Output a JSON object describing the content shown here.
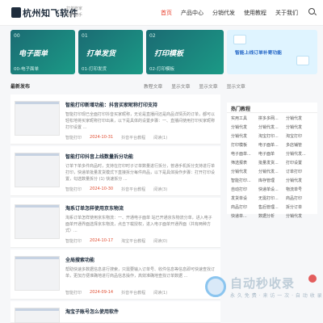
{
  "header": {
    "logo": "杭州知飞软件",
    "slogan": [
      "打单管家",
      "我的助手"
    ],
    "nav": [
      "首页",
      "产品中心",
      "分销代发",
      "使用教程",
      "关于我们"
    ],
    "active": "首页"
  },
  "banners": [
    {
      "num": "00",
      "title": "电子面单",
      "caption": "00-电子面单"
    },
    {
      "num": "01",
      "title": "打单发货",
      "caption": "01-打印发货"
    },
    {
      "num": "02",
      "title": "打印模板",
      "caption": "02-打印模板"
    }
  ],
  "big_banner": {
    "text": "智能上线订单补寄功能"
  },
  "section": {
    "title": "最新发布",
    "tabs": [
      "教程文章",
      "显示文章",
      "显示文章",
      "显示文章"
    ]
  },
  "posts": [
    {
      "title": "智能打印新增功能：抖音买家昵称打印支持",
      "desc": "智能打印现已全面打印抖音买家昵称，无论是直播间还是商品详情页的订单，都可以轻松地将买家昵称打印出来，以下是具体的设置步骤：一、直播间使用打印买家昵称 打印设置 ...",
      "author": "智能打印",
      "date": "2024-10-31",
      "category": "抖音平台教程",
      "views": "阅读(1)"
    },
    {
      "title": "智能打印抖音上线数量拆分功能",
      "desc": "订单下单多件商品时，支持在打印时子订单数量进行拆分，普通手机拆分支持进行单打印，快递单批量发货模式下直接拆分每件商品，以下是具体操作步骤：打开打印设置，勾选数量拆分 (1) 快速拆分 ...",
      "author": "智能打印",
      "date": "2024-10-30",
      "category": "抖音平台教程",
      "views": "阅读(3)"
    },
    {
      "title": "淘系订单怎样使用京东物流",
      "desc": "淘系订单怎样使用京东物流：一、开通电子面单 站已开通京东物流分单，进入电子面单开通界面选择京东物流，点击下载授权，进入电子面单开通界面（共有两种方式）...",
      "author": "智能打印",
      "date": "2024-10-17",
      "category": "淘宝平台教程",
      "views": "阅读(0)"
    },
    {
      "title": "全局搜索功能",
      "desc": "帮助快速多数据信息进行搜索，只需要输入订单号、收件信息等信息即可快速查找订单，更加方便准确地进行商品信息操作，高效准确地查找订单数据 ...",
      "author": "智能打印",
      "date": "2024-09-14",
      "category": "抖音平台教程",
      "views": "阅读(1)"
    },
    {
      "title": "淘宝子账号怎么使用软件",
      "desc": "",
      "author": "智能打印",
      "date": "",
      "category": "",
      "views": ""
    }
  ],
  "sidebar": {
    "title": "热门教程",
    "items": [
      "实用工具",
      "拼多多网...",
      "分销代发",
      "分销代发",
      "分销代发...",
      "分销代发",
      "分销代发",
      "淘宝打印...",
      "淘宝打印",
      "打印模板",
      "电子面单...",
      "多店铺管",
      "电子面单...",
      "电子面单",
      "分销代发...",
      "筛选报表",
      "批量发货...",
      "打印设置",
      "分销代发",
      "分销代发...",
      "订单打印",
      "智能打印...",
      "库存管理",
      "分销代发",
      "自动打印",
      "快递单设...",
      "物流单号",
      "发货单设",
      "无需打印...",
      "商品打印",
      "商品打印",
      "售后管理...",
      "拆分订单",
      "快递单...",
      "数据分析",
      "分销代发"
    ]
  },
  "watermark": {
    "big": "自动秒收录",
    "small": "永 久 免 费 · 来 访 一 次 · 自 动 收 录"
  }
}
